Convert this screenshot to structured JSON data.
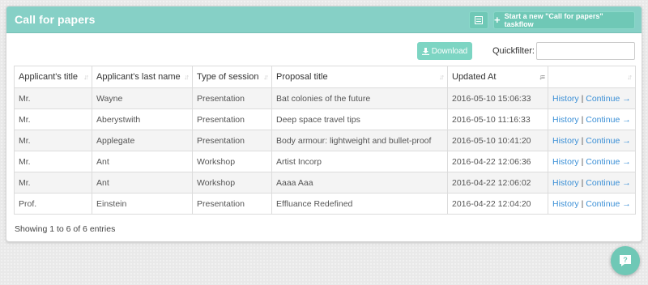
{
  "header": {
    "title": "Call for papers",
    "list_icon": "list-icon",
    "start_label": "Start a new \"Call for papers\" taskflow"
  },
  "toolbar": {
    "download_label": "Download",
    "quickfilter_label": "Quickfilter:",
    "quickfilter_value": ""
  },
  "table": {
    "columns": [
      "Applicant's title",
      "Applicant's last name",
      "Type of session",
      "Proposal title",
      "Updated At",
      ""
    ],
    "rows": [
      {
        "title": "Mr.",
        "last_name": "Wayne",
        "session": "Presentation",
        "proposal": "Bat colonies of the future",
        "updated": "2016-05-10 15:06:33"
      },
      {
        "title": "Mr.",
        "last_name": "Aberystwith",
        "session": "Presentation",
        "proposal": "Deep space travel tips",
        "updated": "2016-05-10 11:16:33"
      },
      {
        "title": "Mr.",
        "last_name": "Applegate",
        "session": "Presentation",
        "proposal": "Body armour: lightweight and bullet-proof",
        "updated": "2016-05-10 10:41:20"
      },
      {
        "title": "Mr.",
        "last_name": "Ant",
        "session": "Workshop",
        "proposal": "Artist Incorp",
        "updated": "2016-04-22 12:06:36"
      },
      {
        "title": "Mr.",
        "last_name": "Ant",
        "session": "Workshop",
        "proposal": "Aaaa Aaa",
        "updated": "2016-04-22 12:06:02"
      },
      {
        "title": "Prof.",
        "last_name": "Einstein",
        "session": "Presentation",
        "proposal": "Effluance Redefined",
        "updated": "2016-04-22 12:04:20"
      }
    ],
    "history_label": "History",
    "separator": "|",
    "continue_label": "Continue →"
  },
  "footer": {
    "info": "Showing 1 to 6 of 6 entries"
  },
  "colors": {
    "header_bg": "#86d0c6",
    "button_bg": "#6fc8b6",
    "link": "#3a8fd6"
  }
}
